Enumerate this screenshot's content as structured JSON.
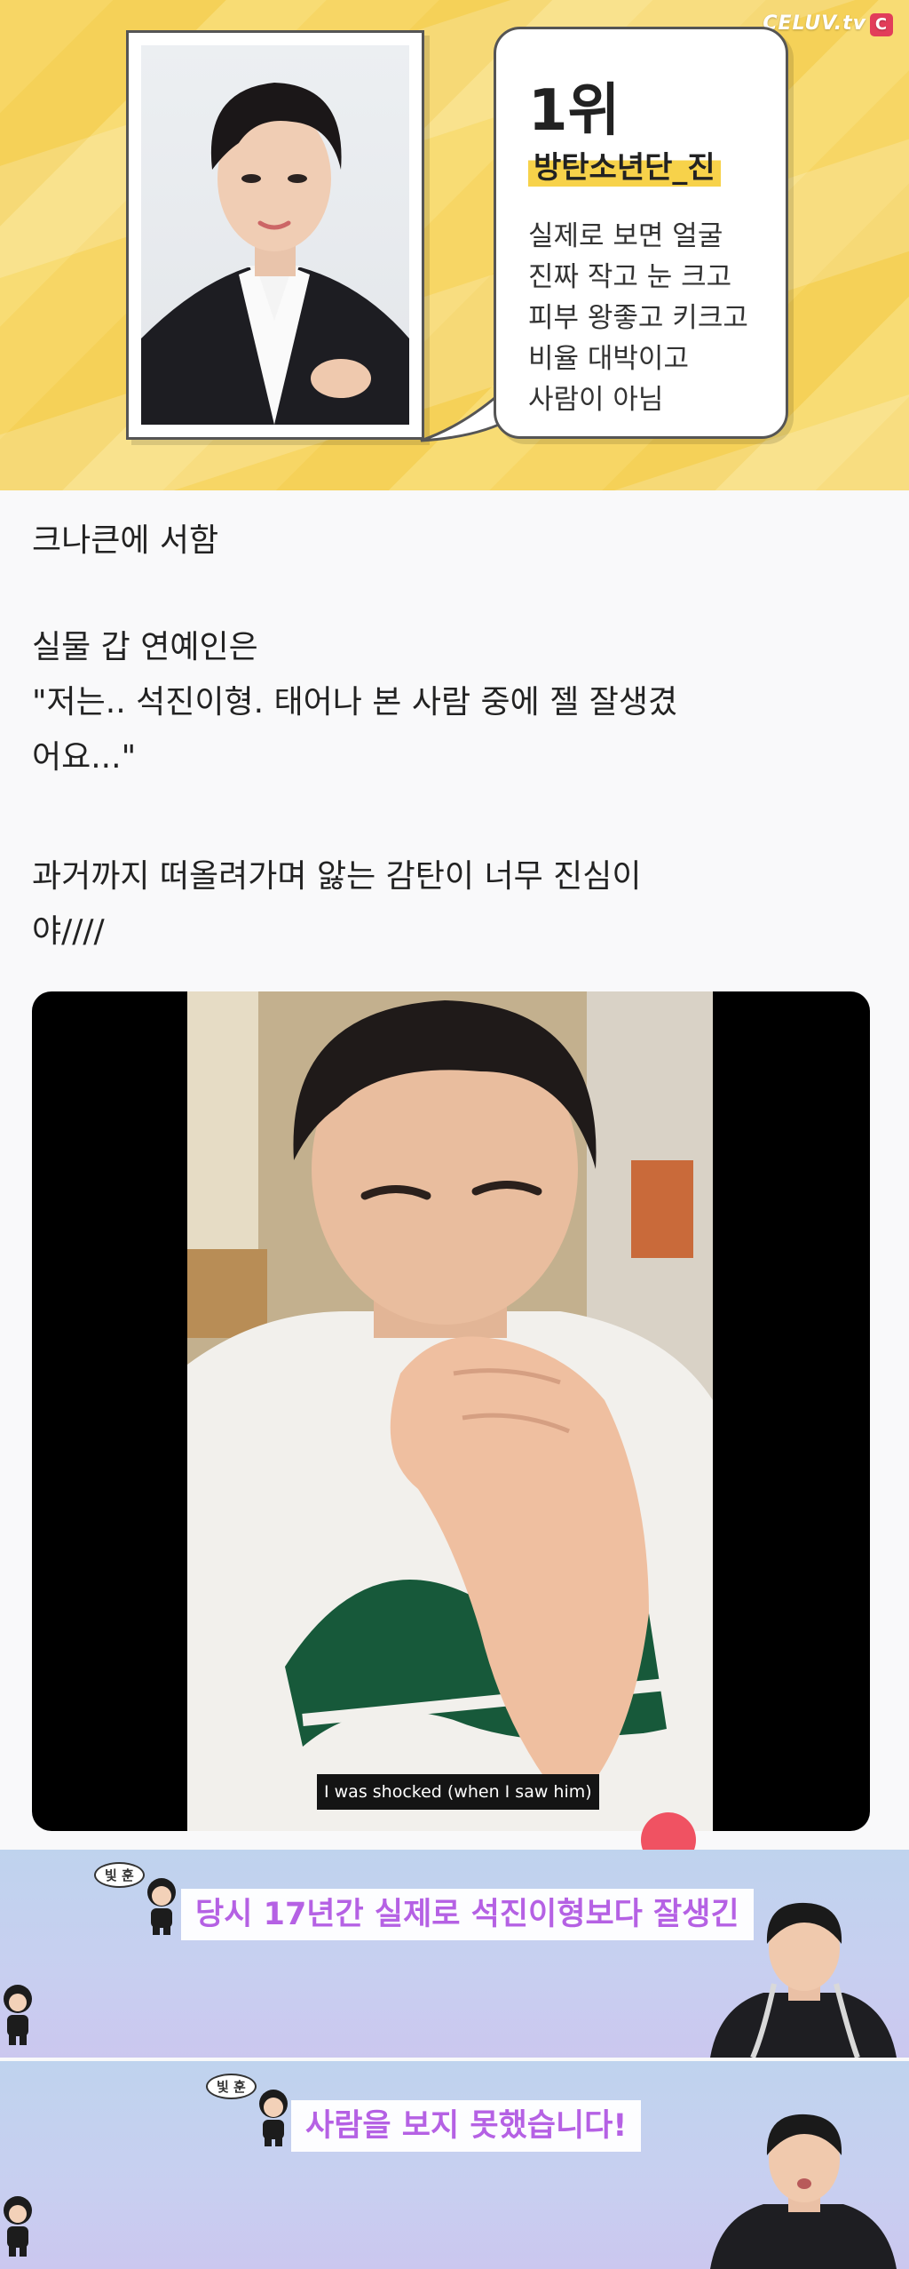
{
  "banner": {
    "logo": "CELUV.tv",
    "logo_badge": "C",
    "rank": "1위",
    "member": "방탄소년단_진",
    "description": [
      "실제로 보면 얼굴",
      "진짜 작고 눈 크고",
      "피부 왕좋고 키크고",
      "비율 대박이고",
      "사람이 아님"
    ]
  },
  "post": {
    "lines": [
      "크나큰에 서함",
      "실물 갑 연예인은",
      " \"저는..  석진이형. 태어나 본 사람 중에 젤 잘생겼",
      "어요...\"",
      "과거까지 떠올려가며 앓는 감탄이 너무 진심이",
      "야////"
    ]
  },
  "video": {
    "subtitle": "I was shocked (when I saw him)"
  },
  "captions": [
    {
      "tag": "빛 훈",
      "text": "당시 17년간 실제로 석진이형보다 잘생긴"
    },
    {
      "tag": "빛 훈",
      "text": "사람을 보지 못했습니다!"
    }
  ],
  "colors": {
    "banner_yellow": "#f7d665",
    "highlight": "#f7d24a",
    "caption_text": "#b561e4",
    "strip_bg": "#c4d0ef"
  }
}
